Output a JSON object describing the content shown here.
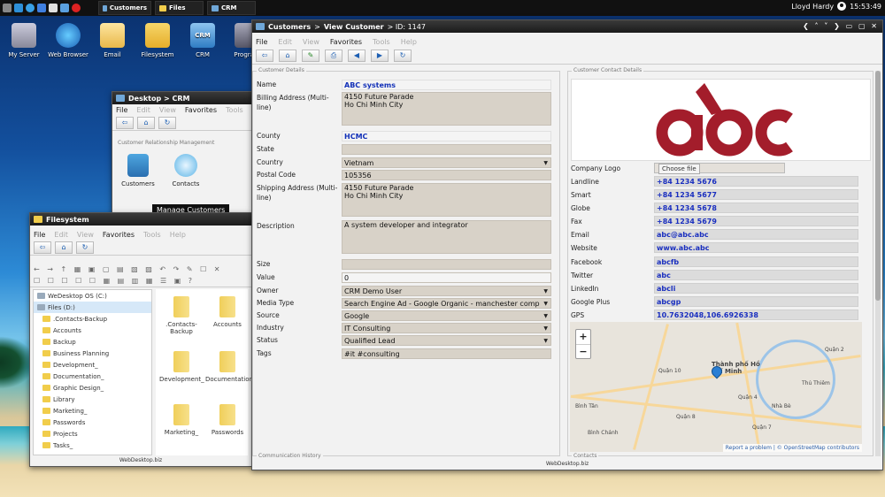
{
  "taskbar": {
    "tasks": [
      "Customers",
      "Files",
      "CRM"
    ],
    "user": "Lloyd Hardy",
    "clock": "15:53:49"
  },
  "desktop_icons": [
    "My Server",
    "Web Browser",
    "Email",
    "Filesystem",
    "CRM",
    "Program"
  ],
  "crm_window": {
    "title": "Desktop > CRM",
    "menu": [
      "File",
      "Edit",
      "View",
      "Favorites",
      "Tools"
    ],
    "section": "Customer Relationship Management",
    "icons": [
      "Customers",
      "Contacts"
    ],
    "tooltip": "Manage Customers"
  },
  "files_window": {
    "title": "Filesystem",
    "menu": [
      "File",
      "Edit",
      "View",
      "Favorites",
      "Tools",
      "Help"
    ],
    "drives": [
      "WeDesktop OS (C:)",
      "Files (D:)"
    ],
    "tree": [
      ".Contacts-Backup",
      "Accounts",
      "Backup",
      "Business Planning",
      "Development_",
      "Documentation_",
      "Graphic Design_",
      "Library",
      "Marketing_",
      "Passwords",
      "Projects",
      "Tasks_"
    ],
    "files": [
      ".Contacts-Backup",
      "Accounts",
      "Development_",
      "Documentation_",
      "Marketing_",
      "Passwords"
    ],
    "status": "WebDesktop.biz"
  },
  "customer_window": {
    "title": {
      "a": "Customers",
      "sep": ">",
      "b": "View Customer",
      "c": "> ID: 1147"
    },
    "menu": [
      "File",
      "Edit",
      "View",
      "Favorites",
      "Tools",
      "Help"
    ],
    "left_legend": "Customer Details",
    "right_legend": "Customer Contact Details",
    "bottom_legend": "Communication History",
    "bottom_legend_r": "Contacts",
    "fields": {
      "name_l": "Name",
      "name": "ABC systems",
      "billing_l": "Billing Address (Multi-line)",
      "billing": "4150 Future Parade\nHo Chi Minh City",
      "county_l": "County",
      "county": "HCMC",
      "state_l": "State",
      "state": "",
      "country_l": "Country",
      "country": "Vietnam",
      "postal_l": "Postal Code",
      "postal": "105356",
      "shipping_l": "Shipping Address (Multi-line)",
      "shipping": "4150 Future Parade\nHo Chi Minh City",
      "desc_l": "Description",
      "desc": "A system developer and integrator",
      "size_l": "Size",
      "size": "",
      "value_l": "Value",
      "value": "0",
      "owner_l": "Owner",
      "owner": "CRM Demo User",
      "media_l": "Media Type",
      "media": "Search Engine Ad - Google Organic - manchester comp",
      "source_l": "Source",
      "source": "Google",
      "industry_l": "Industry",
      "industry": "IT Consulting",
      "status_l": "Status",
      "status": "Qualified Lead",
      "tags_l": "Tags",
      "tags": "#it #consulting"
    },
    "contact": {
      "logo_l": "Company Logo",
      "choose": "Choose file",
      "landline_l": "Landline",
      "landline": "+84 1234 5676",
      "smart_l": "Smart",
      "smart": "+84 1234 5677",
      "globe_l": "Globe",
      "globe": "+84 1234 5678",
      "fax_l": "Fax",
      "fax": "+84 1234 5679",
      "email_l": "Email",
      "email": "abc@abc.abc",
      "web_l": "Website",
      "web": "www.abc.abc",
      "fb_l": "Facebook",
      "fb": "abcfb",
      "tw_l": "Twitter",
      "tw": "abc",
      "li_l": "LinkedIn",
      "li": "abcli",
      "gp_l": "Google Plus",
      "gp": "abcgp",
      "gps_l": "GPS",
      "gps": "10.7632048,106.6926338"
    },
    "map": {
      "labels": [
        "Quận 10",
        "Thành phố Hồ Chí Minh",
        "Bình Tân",
        "Quận 4",
        "Quận 7",
        "Bình Chánh",
        "Quận 2",
        "Thủ Thiêm",
        "Quận 8",
        "Nhà Bè"
      ],
      "attribution": "Report a problem | © OpenStreetMap contributors"
    },
    "status": "WebDesktop.biz"
  },
  "colors": {
    "logo": "#a31d2b",
    "link": "#1230b8"
  }
}
